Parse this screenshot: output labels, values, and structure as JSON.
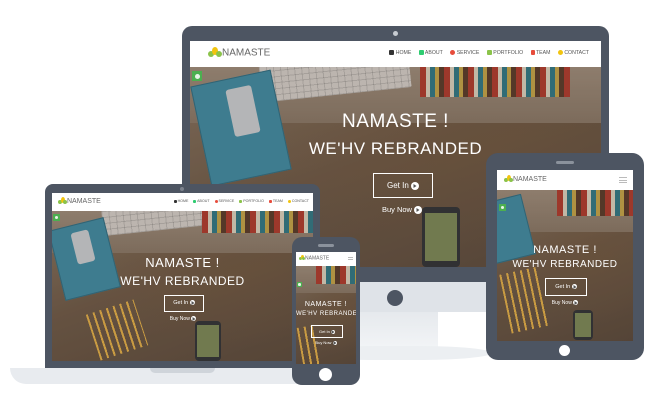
{
  "brand": {
    "name": "NAMASTE"
  },
  "nav": {
    "items": [
      {
        "label": "HOME",
        "icon": "home-icon",
        "color": "#333333"
      },
      {
        "label": "ABOUT",
        "icon": "about-icon",
        "color": "#2ecc71"
      },
      {
        "label": "SERVICE",
        "icon": "service-icon",
        "color": "#e74c3c"
      },
      {
        "label": "PORTFOLIO",
        "icon": "portfolio-icon",
        "color": "#8bc34a"
      },
      {
        "label": "TEAM",
        "icon": "team-icon",
        "color": "#e74c3c"
      },
      {
        "label": "CONTACT",
        "icon": "contact-icon",
        "color": "#f1c40f"
      }
    ]
  },
  "hero": {
    "title": "NAMASTE !",
    "subtitle": "WE'HV REBRANDED",
    "primary_button": "Get In",
    "secondary_button": "Buy Now"
  },
  "colors": {
    "device_frame": "#4d5562",
    "accent_green": "#4caf50",
    "text_on_hero": "#ffffff"
  }
}
